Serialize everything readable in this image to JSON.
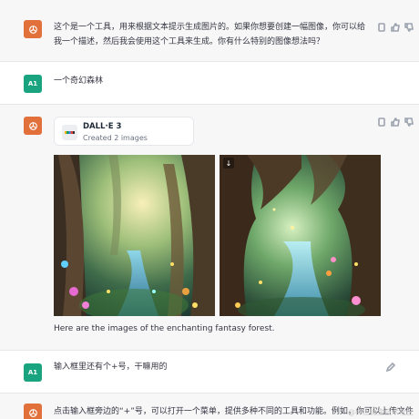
{
  "messages": [
    {
      "role": "assistant",
      "avatar_icon": "openai-logo-icon",
      "text": "这个是一个工具，用来根据文本提示生成图片的。如果你想要创建一幅图像，你可以给我一个描述，然后我会使用这个工具来生成。你有什么特别的图像想法吗？"
    },
    {
      "role": "user",
      "avatar_label": "A1",
      "text": "一个奇幻森林"
    },
    {
      "role": "assistant",
      "avatar_icon": "openai-logo-icon",
      "tool": {
        "name": "DALL·E 3",
        "subtitle": "Created 2 images"
      },
      "images": [
        "fantasy-forest-1",
        "fantasy-forest-2"
      ],
      "caption": "Here are the images of the enchanting fantasy forest."
    },
    {
      "role": "user",
      "avatar_label": "A1",
      "text": "输入框里还有个+号，干嘛用的"
    },
    {
      "role": "assistant",
      "avatar_icon": "openai-logo-icon",
      "text": "点击输入框旁边的“+”号，可以打开一个菜单，提供多种不同的工具和功能。例如，你可以上传文件"
    }
  ],
  "watermark": "@稀土掘金技术社区",
  "colors": {
    "assistant_bg": "#f7f7f8",
    "gpt_avatar": "#e2703a",
    "user_avatar": "#19a37f"
  }
}
